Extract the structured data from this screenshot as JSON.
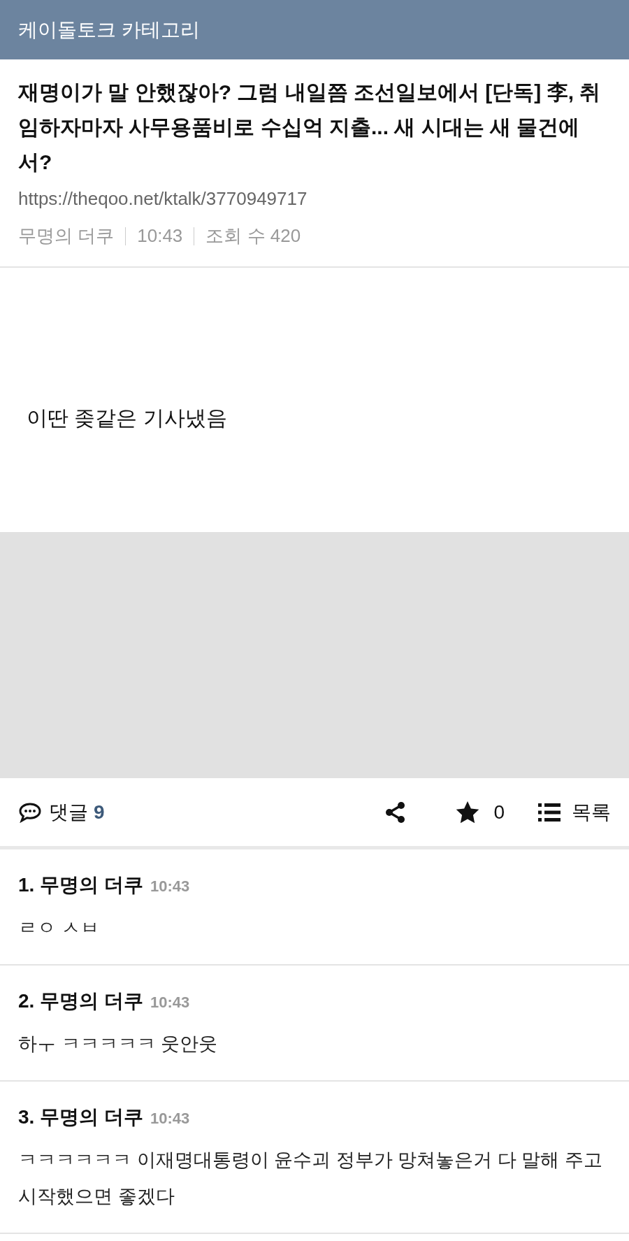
{
  "header": {
    "title": "케이돌토크 카테고리"
  },
  "post": {
    "title": "재명이가 말 안했잖아? 그럼 내일쯤 조선일보에서 [단독] 李, 취임하자마자 사무용품비로 수십억 지출... 새 시대는 새 물건에서?",
    "url": "https://theqoo.net/ktalk/3770949717",
    "author": "무명의 더쿠",
    "time": "10:43",
    "views": "조회 수 420",
    "body": "이딴 좆같은 기사냈음"
  },
  "toolbar": {
    "comments_label": "댓글",
    "comments_count": "9",
    "stars": "0",
    "list_label": "목록"
  },
  "comments": [
    {
      "number": "1.",
      "author": "무명의 더쿠",
      "time": "10:43",
      "text": "ㄹㅇ ㅅㅂ"
    },
    {
      "number": "2.",
      "author": "무명의 더쿠",
      "time": "10:43",
      "text": "하ㅜ ㅋㅋㅋㅋㅋ 웃안웃"
    },
    {
      "number": "3.",
      "author": "무명의 더쿠",
      "time": "10:43",
      "text": "ㅋㅋㅋㅋㅋㅋ 이재명대통령이 윤수괴 정부가 망쳐놓은거 다 말해 주고 시작했으면 좋겠다"
    }
  ]
}
